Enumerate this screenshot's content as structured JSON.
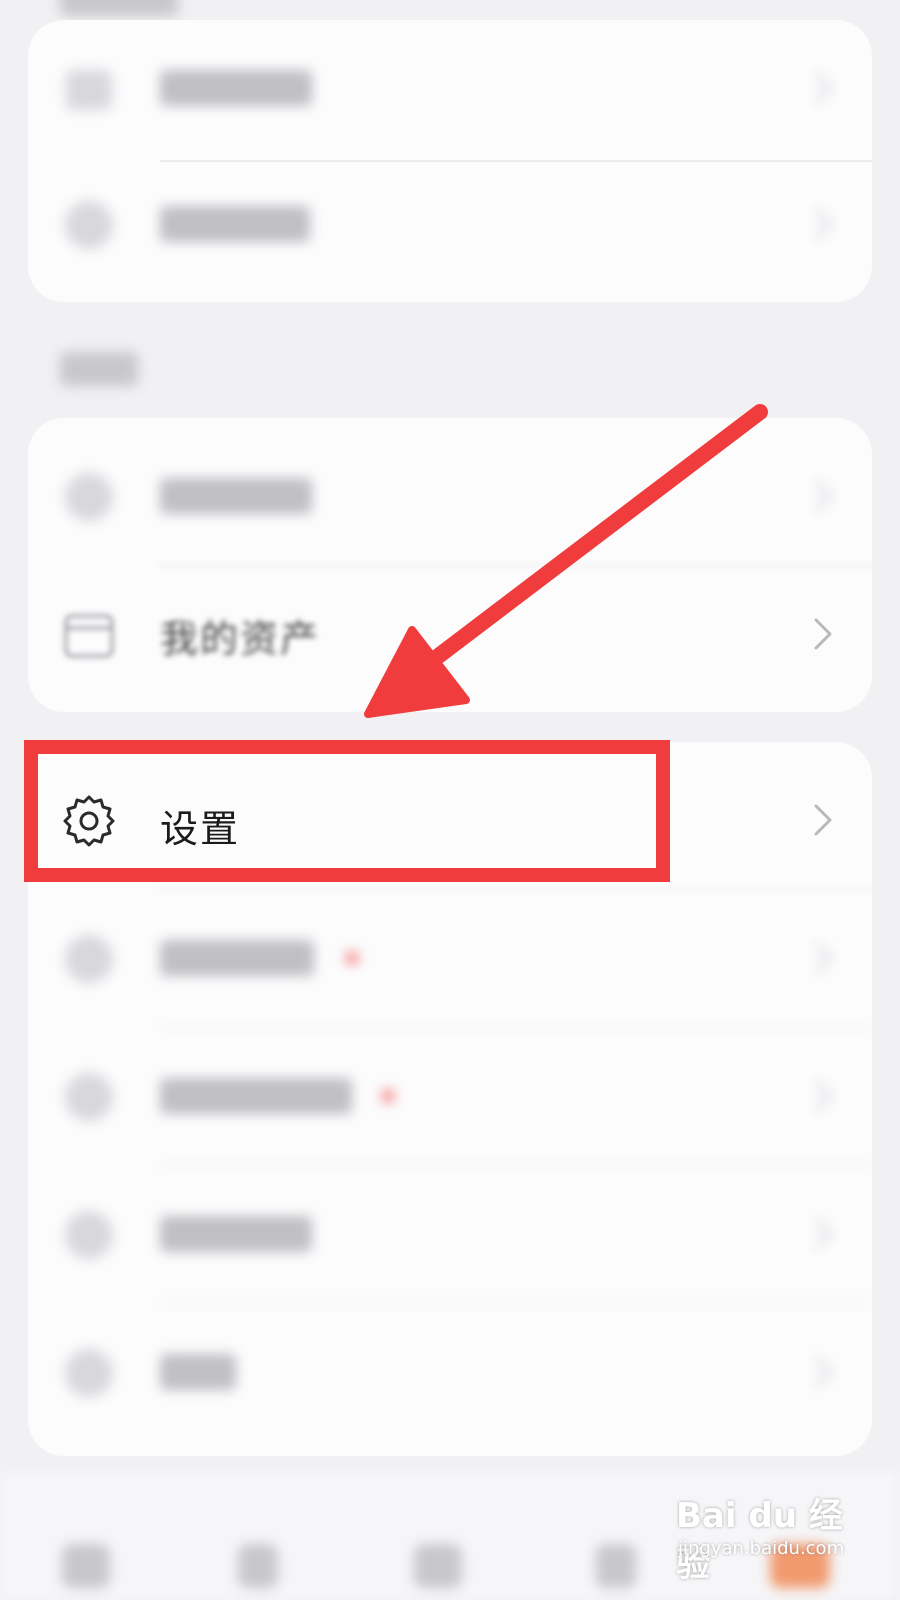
{
  "colors": {
    "background": "#f1f1f3",
    "card": "#fcfcfd",
    "annotation": "#f03c3c",
    "badge": "#f36b6b",
    "chevron": "#b9b9bd"
  },
  "top_card": {
    "items": [
      {
        "label": "",
        "icon": "folder-icon"
      },
      {
        "label": "",
        "icon": "profile-icon"
      }
    ]
  },
  "middle_card": {
    "items": [
      {
        "label": "",
        "icon": "order-icon"
      },
      {
        "label": "我的资产",
        "icon": "wallet-icon"
      }
    ]
  },
  "bottom_card": {
    "settings_label": "设置",
    "settings_icon": "gear-icon",
    "items": [
      {
        "label": "",
        "icon": "service-icon",
        "badge": true
      },
      {
        "label": "",
        "icon": "help-icon",
        "badge": true
      },
      {
        "label": "",
        "icon": "feedback-icon",
        "badge": false
      },
      {
        "label": "",
        "icon": "about-icon",
        "badge": false
      }
    ]
  },
  "annotation": {
    "arrow": "red-arrow",
    "highlight": "red-rectangle"
  },
  "watermark": {
    "logo": "Bai du 经验",
    "url": "jingyan.baidu.com"
  }
}
